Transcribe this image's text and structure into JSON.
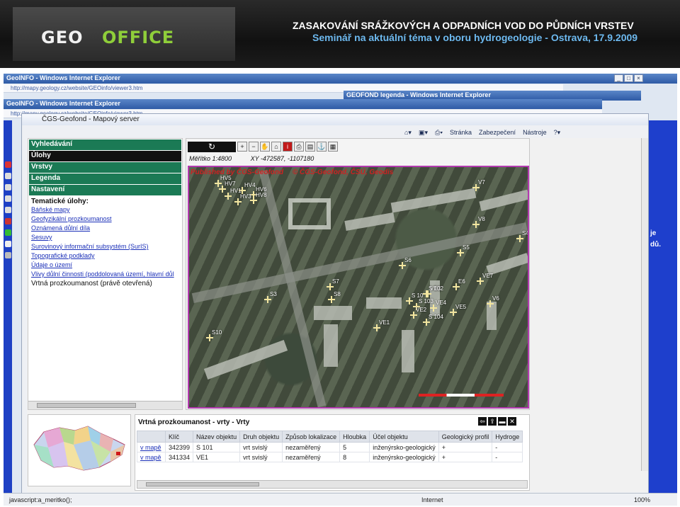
{
  "banner": {
    "logo_left": "GEO",
    "logo_right": "OFFICE",
    "title": "ZASAKOVÁNÍ SRÁŽKOVÝCH A ODPADNÍCH VOD DO PŮDNÍCH VRSTEV",
    "subtitle": "Seminář na aktuální téma v oboru hydrogeologie - Ostrava, 17.9.2009"
  },
  "browser": {
    "window_title": "GeoINFO - Windows Internet Explorer",
    "address": "http://mapy.geology.cz/website/GEOinfo/viewer3.htm",
    "second_window_title": "GEOFOND legenda - Windows Internet Explorer",
    "app_tab_title": "ČGS-Geofond - Mapový server",
    "toolbar": [
      "Stránka",
      "Zabezpečení",
      "Nástroje"
    ],
    "status_left": "javascript:a_meritko();",
    "status_zone": "Internet",
    "status_zoom": "100%",
    "right_text_1": "je",
    "right_text_2": "dů."
  },
  "menu": {
    "headers": [
      "Vyhledávání",
      "Úlohy",
      "Vrstvy",
      "Legenda",
      "Nastavení"
    ],
    "thematic_title": "Tematické úlohy:",
    "thematic_links": [
      "Báňské mapy",
      "Geofyzikální prozkoumanost",
      "Oznámená důlní díla",
      "Sesuvy",
      "Surovinový informační subsystém (SurIS)",
      "Topografické podklady",
      "Údaje o území",
      "Vlivy důlní činnosti (poddolovaná území, hlavní důl"
    ],
    "current_task": "Vrtná prozkoumanost (právě otevřená)"
  },
  "map": {
    "scale_label": "Měřítko 1:4800",
    "coords_label": "XY -472587, -1107180",
    "credit_1": "Published by ČGS-Geofond",
    "credit_2": "© ČGS-Geofond, ČSÚ, Geodis",
    "markers": [
      "V7",
      "HV5",
      "HV7",
      "HV4",
      "HV1",
      "HV6",
      "HV8",
      "HV3",
      "V8",
      "S4",
      "S5",
      "S6",
      "VE7",
      "S7",
      "E6",
      "VE3",
      "S3",
      "S8",
      "S 10",
      "S 102",
      "S 103",
      "VE2",
      "VE4",
      "V6",
      "VE5",
      "S 104",
      "VE1",
      "S10"
    ]
  },
  "results": {
    "title": "Vrtná prozkoumanost - vrty - Vrty",
    "columns": [
      "",
      "Klíč",
      "Název objektu",
      "Druh objektu",
      "Způsob lokalizace",
      "Hloubka",
      "Účel objektu",
      "Geologický profil",
      "Hydroge"
    ],
    "rows": [
      [
        "v mapě",
        "342399",
        "S 101",
        "vrt svislý",
        "nezaměřený",
        "5",
        "inženýrsko-geologický",
        "+",
        "-"
      ],
      [
        "v mapě",
        "341334",
        "VE1",
        "vrt svislý",
        "nezaměřený",
        "8",
        "inženýrsko-geologický",
        "+",
        "-"
      ]
    ]
  },
  "colors": {
    "menu_green": "#1b7a55",
    "map_border": "#b33ab0",
    "link_blue": "#1a2fb8"
  }
}
